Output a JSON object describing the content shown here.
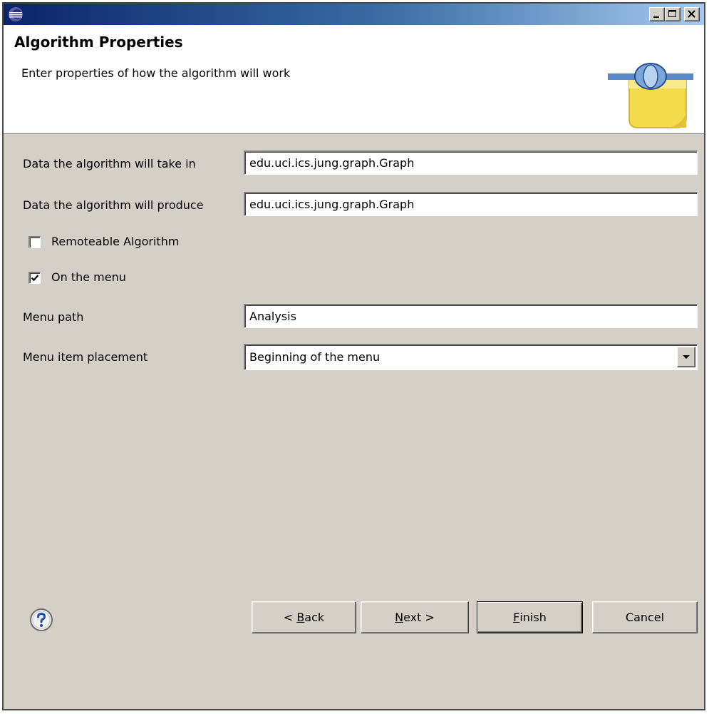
{
  "window": {
    "title": "",
    "controls": {
      "minimize": "minimize",
      "maximize": "maximize",
      "close": "close"
    }
  },
  "banner": {
    "title": "Algorithm Properties",
    "description": "Enter properties of how the algorithm will work",
    "graphic": "plugin-connector-icon"
  },
  "form": {
    "input_data": {
      "label": "Data the algorithm will take in",
      "value": "edu.uci.ics.jung.graph.Graph"
    },
    "output_data": {
      "label": "Data the algorithm will produce",
      "value": "edu.uci.ics.jung.graph.Graph"
    },
    "remoteable": {
      "label": "Remoteable Algorithm",
      "checked": false
    },
    "on_menu": {
      "label": "On the menu",
      "checked": true
    },
    "menu_path": {
      "label": "Menu path",
      "value": "Analysis"
    },
    "menu_placement": {
      "label": "Menu item placement",
      "value": "Beginning of the menu"
    }
  },
  "footer": {
    "help_icon": "help-icon",
    "back": {
      "prefix": "< ",
      "mnemonic": "B",
      "rest": "ack"
    },
    "next": {
      "mnemonic": "N",
      "rest": "ext >"
    },
    "finish": {
      "mnemonic": "F",
      "rest": "inish"
    },
    "cancel": {
      "label": "Cancel"
    }
  }
}
